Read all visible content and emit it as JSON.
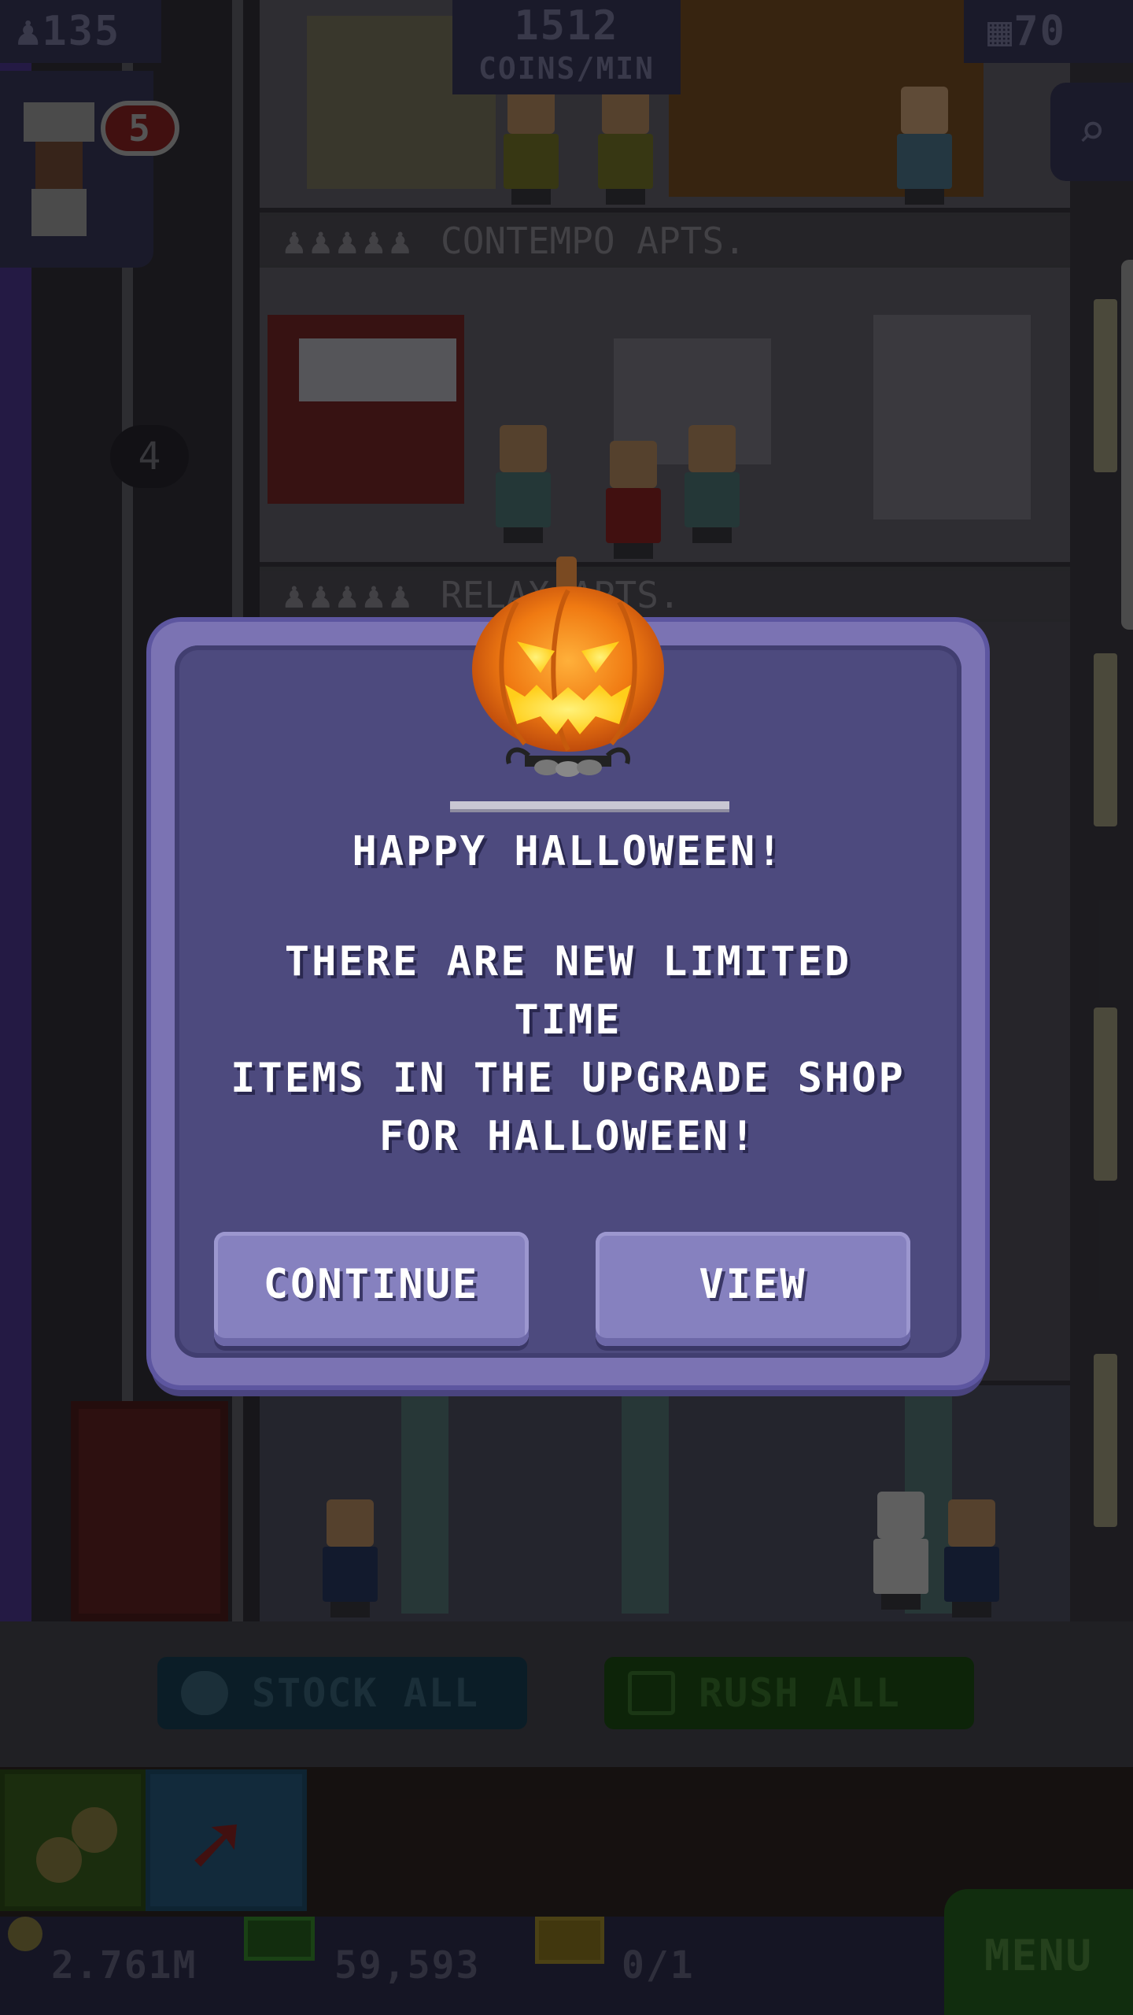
{
  "hud": {
    "population": "135",
    "coins_per_min_value": "1512",
    "coins_per_min_label": "COINS/MIN",
    "floors": "70",
    "chef_badge": "5"
  },
  "floors": {
    "upper_label": "CONTEMPO APTS.",
    "lower_label": "RELAX APTS.",
    "floor_number": "4"
  },
  "dialog": {
    "title": "HAPPY HALLOWEEN!",
    "body": "THERE ARE NEW LIMITED TIME\nITEMS IN THE UPGRADE SHOP\nFOR HALLOWEEN!",
    "continue_label": "CONTINUE",
    "view_label": "VIEW"
  },
  "actions": {
    "stock_all_label": "STOCK ALL",
    "rush_all_label": "RUSH ALL"
  },
  "status": {
    "coins": "2.761M",
    "bux": "59,593",
    "tickets": "0/1",
    "menu_label": "MENU"
  },
  "icons": [
    "person-icon",
    "floors-icon",
    "search-icon",
    "chef-icon",
    "clock-icon",
    "bux-icon",
    "coin-icon",
    "ticket-icon",
    "build-arrow-icon",
    "pumpkin-icon"
  ],
  "colors": {
    "dialog_outer": "#7b73b3",
    "dialog_inner": "#4d4a7e",
    "button": "#8681bf",
    "text": "#ffffff"
  }
}
